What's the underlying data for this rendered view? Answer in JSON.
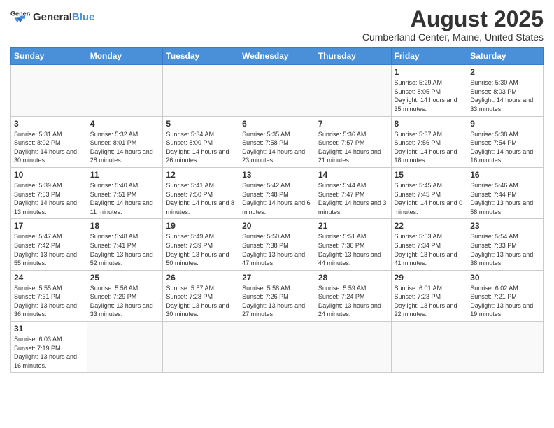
{
  "header": {
    "logo_general": "General",
    "logo_blue": "Blue",
    "main_title": "August 2025",
    "subtitle": "Cumberland Center, Maine, United States"
  },
  "calendar": {
    "days_of_week": [
      "Sunday",
      "Monday",
      "Tuesday",
      "Wednesday",
      "Thursday",
      "Friday",
      "Saturday"
    ],
    "weeks": [
      [
        {
          "day": "",
          "info": ""
        },
        {
          "day": "",
          "info": ""
        },
        {
          "day": "",
          "info": ""
        },
        {
          "day": "",
          "info": ""
        },
        {
          "day": "",
          "info": ""
        },
        {
          "day": "1",
          "info": "Sunrise: 5:29 AM\nSunset: 8:05 PM\nDaylight: 14 hours and 35 minutes."
        },
        {
          "day": "2",
          "info": "Sunrise: 5:30 AM\nSunset: 8:03 PM\nDaylight: 14 hours and 33 minutes."
        }
      ],
      [
        {
          "day": "3",
          "info": "Sunrise: 5:31 AM\nSunset: 8:02 PM\nDaylight: 14 hours and 30 minutes."
        },
        {
          "day": "4",
          "info": "Sunrise: 5:32 AM\nSunset: 8:01 PM\nDaylight: 14 hours and 28 minutes."
        },
        {
          "day": "5",
          "info": "Sunrise: 5:34 AM\nSunset: 8:00 PM\nDaylight: 14 hours and 26 minutes."
        },
        {
          "day": "6",
          "info": "Sunrise: 5:35 AM\nSunset: 7:58 PM\nDaylight: 14 hours and 23 minutes."
        },
        {
          "day": "7",
          "info": "Sunrise: 5:36 AM\nSunset: 7:57 PM\nDaylight: 14 hours and 21 minutes."
        },
        {
          "day": "8",
          "info": "Sunrise: 5:37 AM\nSunset: 7:56 PM\nDaylight: 14 hours and 18 minutes."
        },
        {
          "day": "9",
          "info": "Sunrise: 5:38 AM\nSunset: 7:54 PM\nDaylight: 14 hours and 16 minutes."
        }
      ],
      [
        {
          "day": "10",
          "info": "Sunrise: 5:39 AM\nSunset: 7:53 PM\nDaylight: 14 hours and 13 minutes."
        },
        {
          "day": "11",
          "info": "Sunrise: 5:40 AM\nSunset: 7:51 PM\nDaylight: 14 hours and 11 minutes."
        },
        {
          "day": "12",
          "info": "Sunrise: 5:41 AM\nSunset: 7:50 PM\nDaylight: 14 hours and 8 minutes."
        },
        {
          "day": "13",
          "info": "Sunrise: 5:42 AM\nSunset: 7:48 PM\nDaylight: 14 hours and 6 minutes."
        },
        {
          "day": "14",
          "info": "Sunrise: 5:44 AM\nSunset: 7:47 PM\nDaylight: 14 hours and 3 minutes."
        },
        {
          "day": "15",
          "info": "Sunrise: 5:45 AM\nSunset: 7:45 PM\nDaylight: 14 hours and 0 minutes."
        },
        {
          "day": "16",
          "info": "Sunrise: 5:46 AM\nSunset: 7:44 PM\nDaylight: 13 hours and 58 minutes."
        }
      ],
      [
        {
          "day": "17",
          "info": "Sunrise: 5:47 AM\nSunset: 7:42 PM\nDaylight: 13 hours and 55 minutes."
        },
        {
          "day": "18",
          "info": "Sunrise: 5:48 AM\nSunset: 7:41 PM\nDaylight: 13 hours and 52 minutes."
        },
        {
          "day": "19",
          "info": "Sunrise: 5:49 AM\nSunset: 7:39 PM\nDaylight: 13 hours and 50 minutes."
        },
        {
          "day": "20",
          "info": "Sunrise: 5:50 AM\nSunset: 7:38 PM\nDaylight: 13 hours and 47 minutes."
        },
        {
          "day": "21",
          "info": "Sunrise: 5:51 AM\nSunset: 7:36 PM\nDaylight: 13 hours and 44 minutes."
        },
        {
          "day": "22",
          "info": "Sunrise: 5:53 AM\nSunset: 7:34 PM\nDaylight: 13 hours and 41 minutes."
        },
        {
          "day": "23",
          "info": "Sunrise: 5:54 AM\nSunset: 7:33 PM\nDaylight: 13 hours and 38 minutes."
        }
      ],
      [
        {
          "day": "24",
          "info": "Sunrise: 5:55 AM\nSunset: 7:31 PM\nDaylight: 13 hours and 36 minutes."
        },
        {
          "day": "25",
          "info": "Sunrise: 5:56 AM\nSunset: 7:29 PM\nDaylight: 13 hours and 33 minutes."
        },
        {
          "day": "26",
          "info": "Sunrise: 5:57 AM\nSunset: 7:28 PM\nDaylight: 13 hours and 30 minutes."
        },
        {
          "day": "27",
          "info": "Sunrise: 5:58 AM\nSunset: 7:26 PM\nDaylight: 13 hours and 27 minutes."
        },
        {
          "day": "28",
          "info": "Sunrise: 5:59 AM\nSunset: 7:24 PM\nDaylight: 13 hours and 24 minutes."
        },
        {
          "day": "29",
          "info": "Sunrise: 6:01 AM\nSunset: 7:23 PM\nDaylight: 13 hours and 22 minutes."
        },
        {
          "day": "30",
          "info": "Sunrise: 6:02 AM\nSunset: 7:21 PM\nDaylight: 13 hours and 19 minutes."
        }
      ],
      [
        {
          "day": "31",
          "info": "Sunrise: 6:03 AM\nSunset: 7:19 PM\nDaylight: 13 hours and 16 minutes."
        },
        {
          "day": "",
          "info": ""
        },
        {
          "day": "",
          "info": ""
        },
        {
          "day": "",
          "info": ""
        },
        {
          "day": "",
          "info": ""
        },
        {
          "day": "",
          "info": ""
        },
        {
          "day": "",
          "info": ""
        }
      ]
    ]
  }
}
